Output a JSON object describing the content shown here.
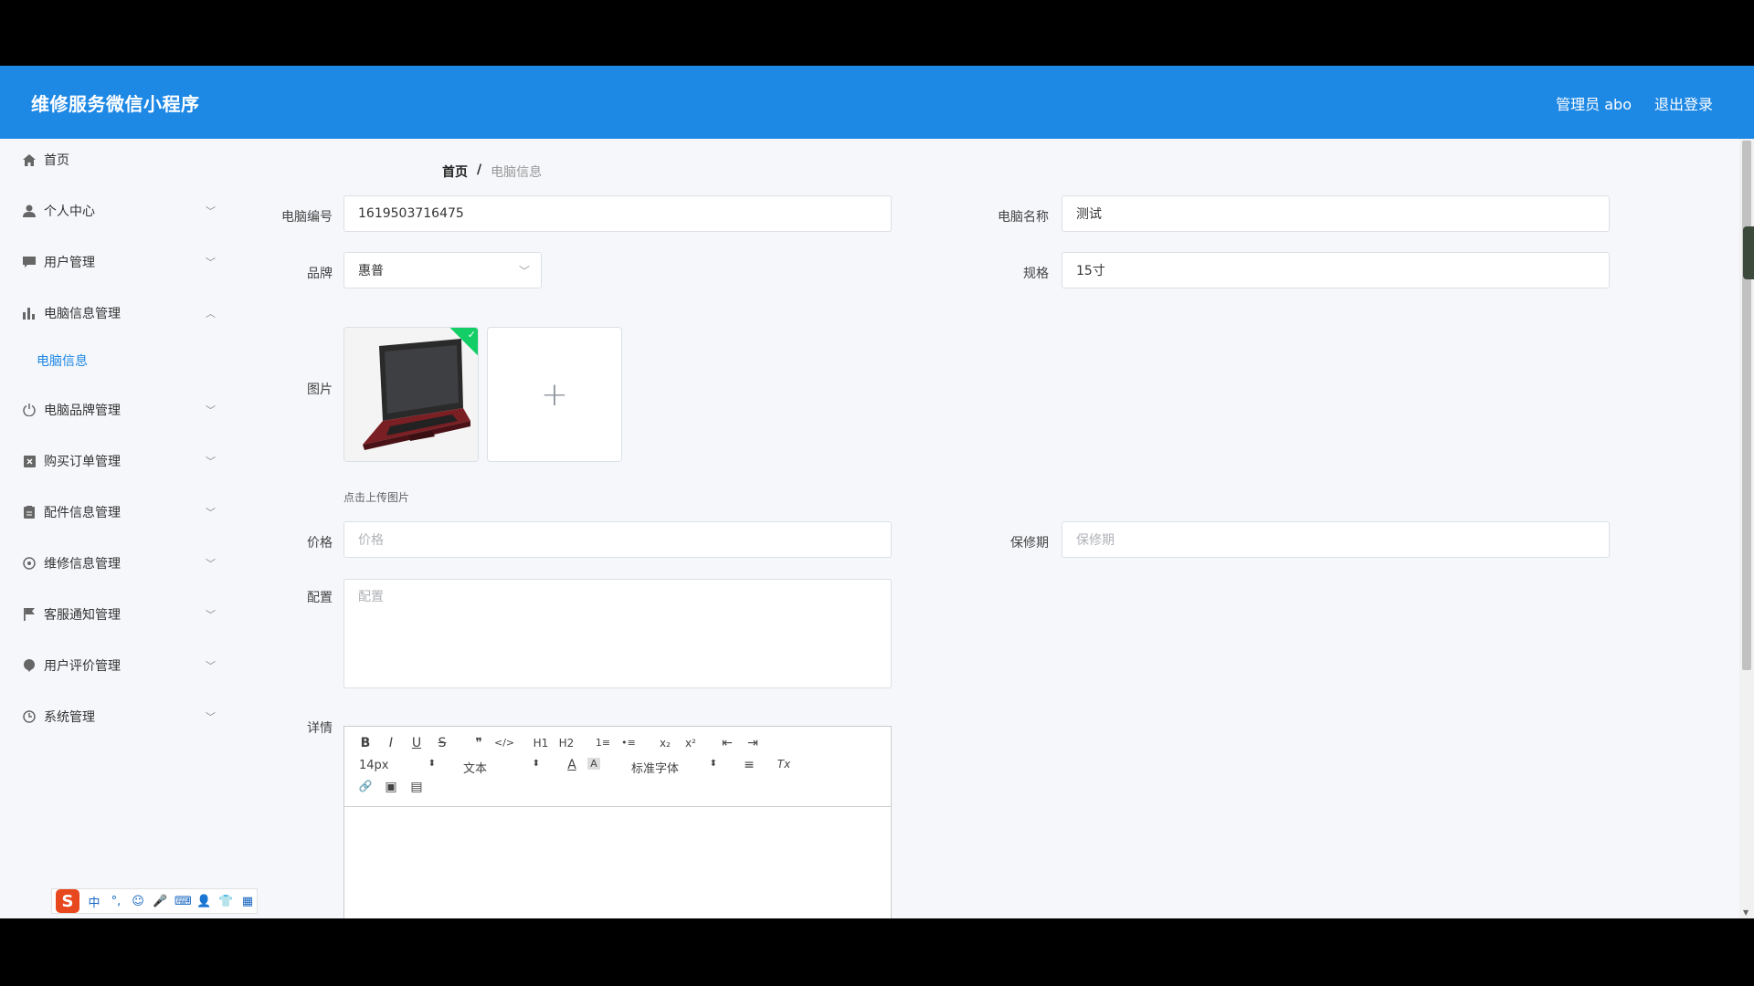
{
  "header": {
    "app_title": "维修服务微信小程序",
    "admin_label": "管理员 abo",
    "logout_label": "退出登录"
  },
  "sidebar": {
    "items": [
      {
        "label": "首页",
        "icon": "home-icon"
      },
      {
        "label": "个人中心",
        "icon": "user-icon"
      },
      {
        "label": "用户管理",
        "icon": "chat-icon"
      },
      {
        "label": "电脑信息管理",
        "icon": "bar-chart-icon"
      },
      {
        "label": "电脑品牌管理",
        "icon": "power-icon"
      },
      {
        "label": "购买订单管理",
        "icon": "clipboard-x-icon"
      },
      {
        "label": "配件信息管理",
        "icon": "document-icon"
      },
      {
        "label": "维修信息管理",
        "icon": "target-icon"
      },
      {
        "label": "客服通知管理",
        "icon": "flag-icon"
      },
      {
        "label": "用户评价管理",
        "icon": "pin-icon"
      },
      {
        "label": "系统管理",
        "icon": "clock-icon"
      }
    ],
    "submenu": {
      "label": "电脑信息"
    }
  },
  "breadcrumb": {
    "home": "首页",
    "separator": "/",
    "current": "电脑信息"
  },
  "form": {
    "computer_no": {
      "label": "电脑编号",
      "value": "1619503716475"
    },
    "computer_name": {
      "label": "电脑名称",
      "value": "测试"
    },
    "brand": {
      "label": "品牌",
      "value": "惠普"
    },
    "spec": {
      "label": "规格",
      "value": "15寸"
    },
    "image": {
      "label": "图片",
      "tip": "点击上传图片"
    },
    "price": {
      "label": "价格",
      "placeholder": "价格"
    },
    "warranty": {
      "label": "保修期",
      "placeholder": "保修期"
    },
    "config": {
      "label": "配置",
      "placeholder": "配置"
    },
    "detail": {
      "label": "详情"
    }
  },
  "editor": {
    "font_size": "14px",
    "block_type": "文本",
    "font_family": "标准字体",
    "buttons": {
      "bold": "B",
      "italic": "I",
      "underline": "U",
      "strike": "S",
      "quote": "❞",
      "code": "</>",
      "h1": "H1",
      "h2": "H2",
      "ordered": "1≡",
      "bullet": "•≡",
      "sub": "x₂",
      "sup": "x²",
      "outdent": "⇤",
      "indent": "⇥",
      "color": "A",
      "bg": "A",
      "align": "≡",
      "clean": "Tx",
      "link": "🔗",
      "img": "▣",
      "video": "▤"
    }
  },
  "ime": {
    "logo": "S",
    "lang": "中",
    "punct": "°,",
    "emoji": "☺",
    "mic": "🎤",
    "keyboard": "⌨",
    "skin": "👤",
    "shirt": "👕",
    "grid": "▦"
  }
}
